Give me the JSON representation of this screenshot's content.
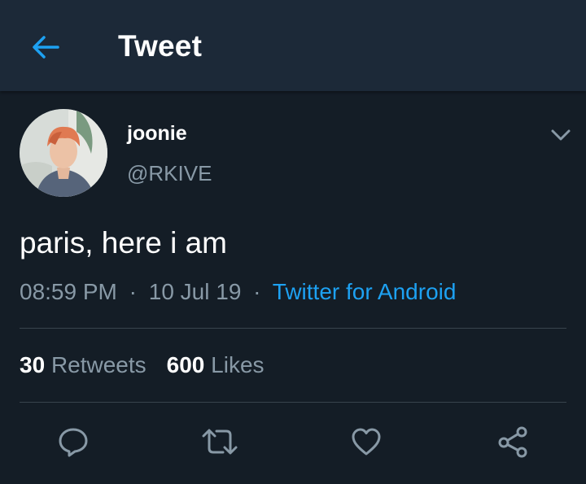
{
  "header": {
    "title": "Tweet",
    "back_icon": "arrow-left-icon"
  },
  "tweet": {
    "display_name": "joonie",
    "handle": "@RKIVE",
    "text": "paris, here i am",
    "time": "08:59 PM",
    "date": "10 Jul 19",
    "separator": "·",
    "source": "Twitter for Android",
    "menu_icon": "chevron-down-icon"
  },
  "stats": {
    "retweets_count": "30",
    "retweets_label": "Retweets",
    "likes_count": "600",
    "likes_label": "Likes"
  },
  "actions": [
    {
      "name": "reply",
      "icon": "reply-icon"
    },
    {
      "name": "retweet",
      "icon": "retweet-icon"
    },
    {
      "name": "like",
      "icon": "heart-icon"
    },
    {
      "name": "share",
      "icon": "share-icon"
    }
  ],
  "colors": {
    "background": "#141d26",
    "header": "#1c2938",
    "accent": "#1da1f2",
    "secondary_text": "#8899a6",
    "divider": "#38444d"
  }
}
